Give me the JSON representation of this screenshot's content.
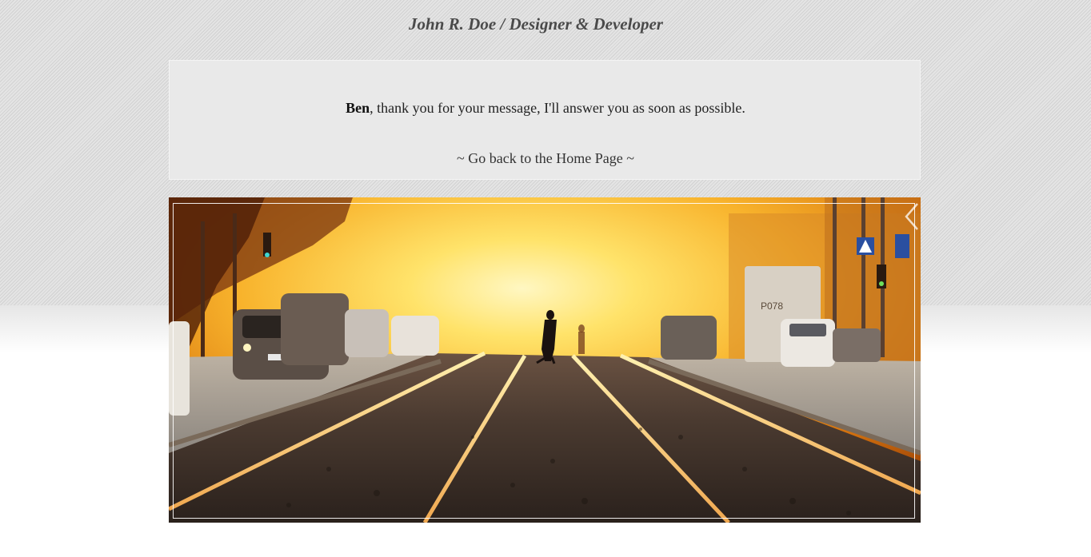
{
  "header": {
    "title": "John R. Doe / Designer & Developer"
  },
  "message": {
    "name": "Ben",
    "text": ", thank you for your message, I'll answer you as soon as possible.",
    "home_link": "~ Go back to the Home Page ~"
  },
  "photo": {
    "sign_text": "Р078"
  },
  "colors": {
    "background_texture": "#dadada",
    "message_box": "#e9e9e9",
    "title_text": "#4a4a4a",
    "sky_glow": "#ffd54a",
    "rail_glow": "#f4b860"
  }
}
